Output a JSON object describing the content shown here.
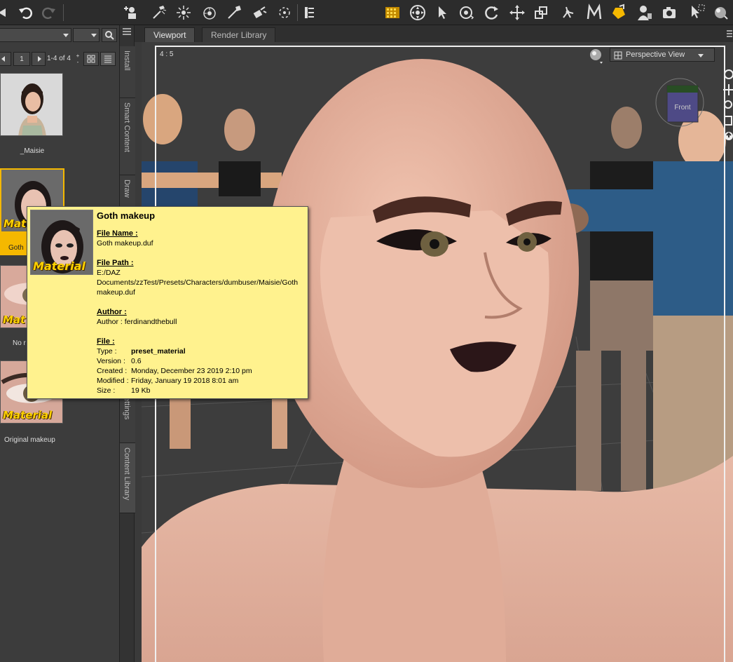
{
  "viewport_tabs": [
    {
      "label": "Viewport",
      "active": true
    },
    {
      "label": "Render Library",
      "active": false
    }
  ],
  "side_tabs": [
    "Install",
    "Smart Content",
    "Draw",
    "ettings",
    "Content Library"
  ],
  "pager": {
    "page": "1",
    "range": "1-4 of 4"
  },
  "items": [
    {
      "label": "_Maisie",
      "badge": ""
    },
    {
      "label": "Goth",
      "badge": "Mat"
    },
    {
      "label": "No r",
      "badge": "Mat"
    },
    {
      "label": "Original makeup",
      "badge": "Material"
    }
  ],
  "viewport": {
    "aspect": "4 : 5",
    "view": "Perspective View",
    "cube_label": "Front"
  },
  "tooltip": {
    "title": "Goth makeup",
    "badge": "Material",
    "file_name_header": "File Name :",
    "file_name": "Goth makeup.duf",
    "file_path_header": "File Path :",
    "file_path_lines": [
      "E:/DAZ",
      "Documents/zzTest/Presets/Characters/dumbuser/Maisie/Goth",
      "makeup.duf"
    ],
    "author_header": "Author :",
    "author_line": "Author : ferdinandthebull",
    "file_header": "File :",
    "type_key": "Type :",
    "type_val": "preset_material",
    "version_key": "Version :",
    "version_val": "0.6",
    "created_key": "Created :",
    "created_val": "Monday, December 23 2019 2:10 pm",
    "modified_key": "Modified :",
    "modified_val": "Friday, January 19 2018 8:01 am",
    "size_key": "Size :",
    "size_val": "19 Kb"
  },
  "colors": {
    "accent": "#f5b800",
    "tooltip_bg": "#fff28e",
    "material_text": "#ffd200"
  },
  "icons": [
    "undo-icon",
    "redo-icon",
    "add-figure-icon",
    "spotlight-icon",
    "light-icon",
    "camera-sphere-icon",
    "wand-icon",
    "pose-icon",
    "node-select-icon",
    "layout-icon",
    "grid-icon",
    "universal-tool-icon",
    "pointer-icon",
    "rotate-camera-icon",
    "rotate-icon",
    "translate-icon",
    "scale-icon",
    "joint-editor-icon",
    "morph-icon",
    "surface-tool-icon",
    "figure-icon",
    "render-icon",
    "spot-render-icon",
    "sphere-icon"
  ]
}
